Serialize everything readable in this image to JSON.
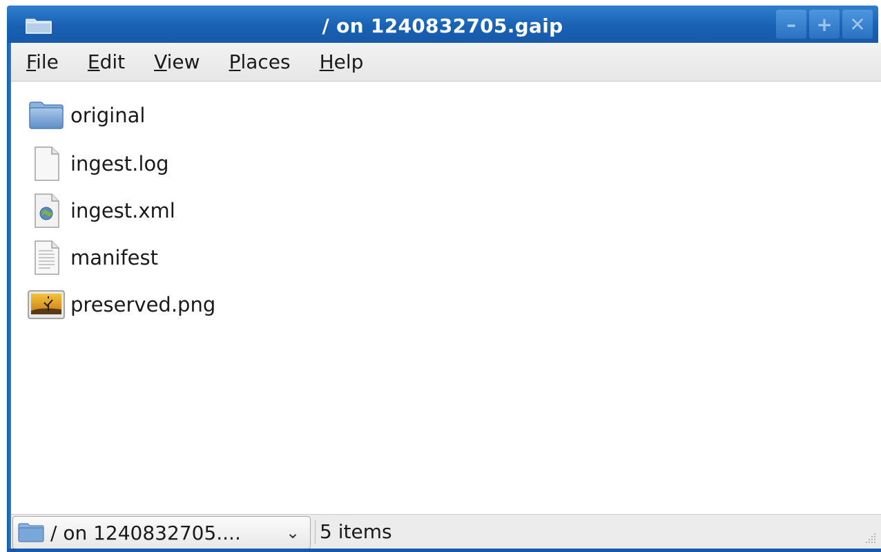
{
  "window": {
    "title": "/ on 1240832705.gaip",
    "buttons": {
      "minimize": "–",
      "maximize": "+",
      "close": "✕"
    }
  },
  "menu": [
    {
      "label_ul": "F",
      "label_rest": "ile"
    },
    {
      "label_ul": "E",
      "label_rest": "dit"
    },
    {
      "label_ul": "V",
      "label_rest": "iew"
    },
    {
      "label_ul": "P",
      "label_rest": "laces"
    },
    {
      "label_ul": "H",
      "label_rest": "elp"
    }
  ],
  "files": [
    {
      "name": "original",
      "icon": "folder-icon"
    },
    {
      "name": "ingest.log",
      "icon": "blank-file-icon"
    },
    {
      "name": "ingest.xml",
      "icon": "xml-file-icon"
    },
    {
      "name": "manifest",
      "icon": "text-file-icon"
    },
    {
      "name": "preserved.png",
      "icon": "image-file-icon"
    }
  ],
  "statusbar": {
    "location": "/ on 1240832705....",
    "arrow": "⌄",
    "item_count": "5 items"
  },
  "colors": {
    "titlebar": "#1a61b3",
    "folder": "#7aa7d9"
  }
}
